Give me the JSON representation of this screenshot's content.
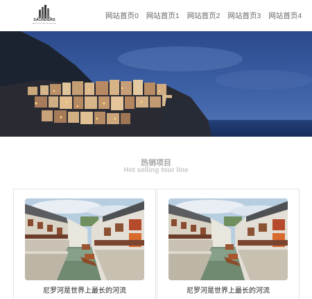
{
  "header": {
    "logo_text": "SAUNDERS",
    "nav": [
      "网站首页0",
      "网站首页1",
      "网站首页2",
      "网站首页3",
      "网站首页4"
    ]
  },
  "section": {
    "title": "热销项目",
    "subtitle": "Hot selling tour line"
  },
  "cards": [
    {
      "title": "尼罗河是世界上最长的河流"
    },
    {
      "title": "尼罗河是世界上最长的河流"
    }
  ]
}
